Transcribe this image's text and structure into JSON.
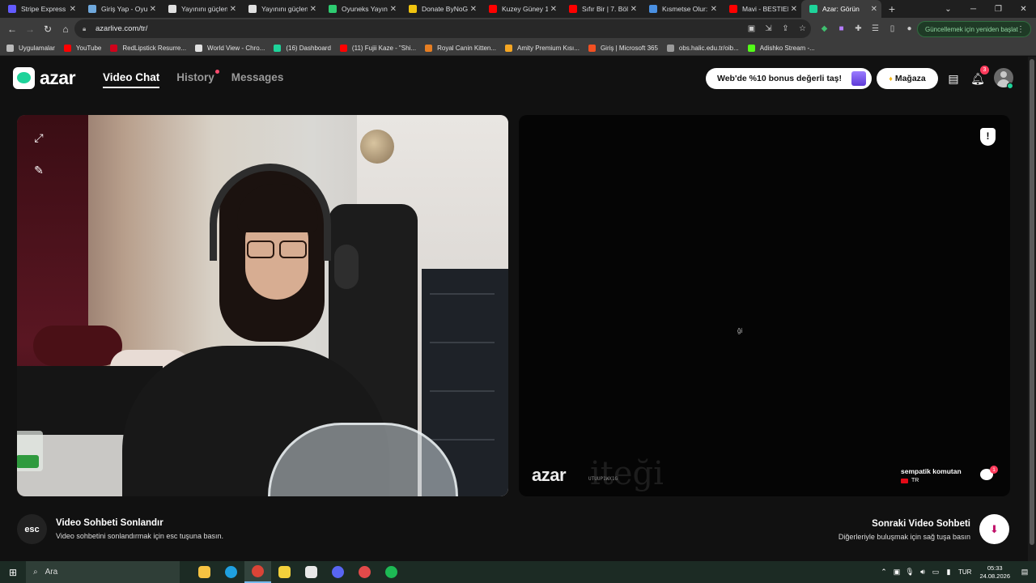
{
  "browser": {
    "tabs": [
      {
        "title": "Stripe Express",
        "color": "#635bff",
        "active": false
      },
      {
        "title": "Giriş Yap - Oyun",
        "color": "#6fa8dc",
        "active": false
      },
      {
        "title": "Yayınını güçlend",
        "color": "#e0e0e0",
        "active": false
      },
      {
        "title": "Yayınını güçlend",
        "color": "#e0e0e0",
        "active": false
      },
      {
        "title": "Oyuneks Yayınc",
        "color": "#2ecc71",
        "active": false
      },
      {
        "title": "Donate ByNoGa",
        "color": "#f1c40f",
        "active": false
      },
      {
        "title": "Kuzey Güney 1.",
        "color": "#ff0000",
        "active": false
      },
      {
        "title": "Sıfır Bir | 7. Bölü",
        "color": "#ff0000",
        "active": false
      },
      {
        "title": "Kısmetse Olur: A",
        "color": "#4a90e2",
        "active": false
      },
      {
        "title": "Mavi - BESTIEEE",
        "color": "#ff0000",
        "active": false
      },
      {
        "title": "Azar: Görün",
        "color": "#1ed39a",
        "active": true
      }
    ],
    "new_tab": "+",
    "url": "azarlive.com/tr/",
    "update_label": "Güncellemek için yeniden başlat",
    "bookmarks": [
      {
        "label": "Uygulamalar",
        "color": "#bbbbbb"
      },
      {
        "label": "YouTube",
        "color": "#ff0000"
      },
      {
        "label": "RedLipstick Resurre...",
        "color": "#d0021b"
      },
      {
        "label": "World View - Chro...",
        "color": "#e0e0e0"
      },
      {
        "label": "(16) Dashboard",
        "color": "#1ed39a"
      },
      {
        "label": "(11) Fujii Kaze - \"Shi...",
        "color": "#ff0000"
      },
      {
        "label": "Royal Canin Kitten...",
        "color": "#e67e22"
      },
      {
        "label": "Amity Premium Kısı...",
        "color": "#f5a623"
      },
      {
        "label": "Giriş | Microsoft 365",
        "color": "#f25022"
      },
      {
        "label": "obs.halic.edu.tr/oib...",
        "color": "#9b9b9b"
      },
      {
        "label": "Adishko Stream -...",
        "color": "#53fc18"
      }
    ]
  },
  "app": {
    "logo_text": "azar",
    "nav": [
      {
        "label": "Video Chat",
        "active": true
      },
      {
        "label": "History",
        "active": false,
        "dot": true
      },
      {
        "label": "Messages",
        "active": false
      }
    ],
    "promo_label": "Web'de %10 bonus değerli taş!",
    "store_label": "Mağaza",
    "notification_count": "3",
    "accent_color": "#1ed39a"
  },
  "video": {
    "remote_loading_text": "ği",
    "watermark_logo": "azar",
    "watermark_id": "UTUUP1WX1G",
    "peer_name": "sempatik komutan",
    "peer_country": "TR",
    "chat_badge": "1"
  },
  "footer": {
    "esc_key": "esc",
    "end_title": "Video Sohbeti Sonlandır",
    "end_sub": "Video sohbetini sonlandırmak için esc tuşuna basın.",
    "next_title": "Sonraki Video Sohbeti",
    "next_sub": "Diğerleriyle buluşmak için sağ tuşa basın"
  },
  "taskbar": {
    "search_label": "Ara",
    "language": "TUR",
    "time": "05:33",
    "date": "24.08.2026",
    "apps": [
      {
        "name": "file-explorer",
        "color": "#f6c342"
      },
      {
        "name": "edge",
        "color": "#1fa0e0"
      },
      {
        "name": "chrome",
        "color": "#db4437",
        "active": true
      },
      {
        "name": "notes",
        "color": "#f2d03b"
      },
      {
        "name": "obs",
        "color": "#e8e8e8"
      },
      {
        "name": "discord",
        "color": "#5865f2"
      },
      {
        "name": "app-circle",
        "color": "#e24a4a"
      },
      {
        "name": "spotify",
        "color": "#1db954"
      }
    ]
  }
}
